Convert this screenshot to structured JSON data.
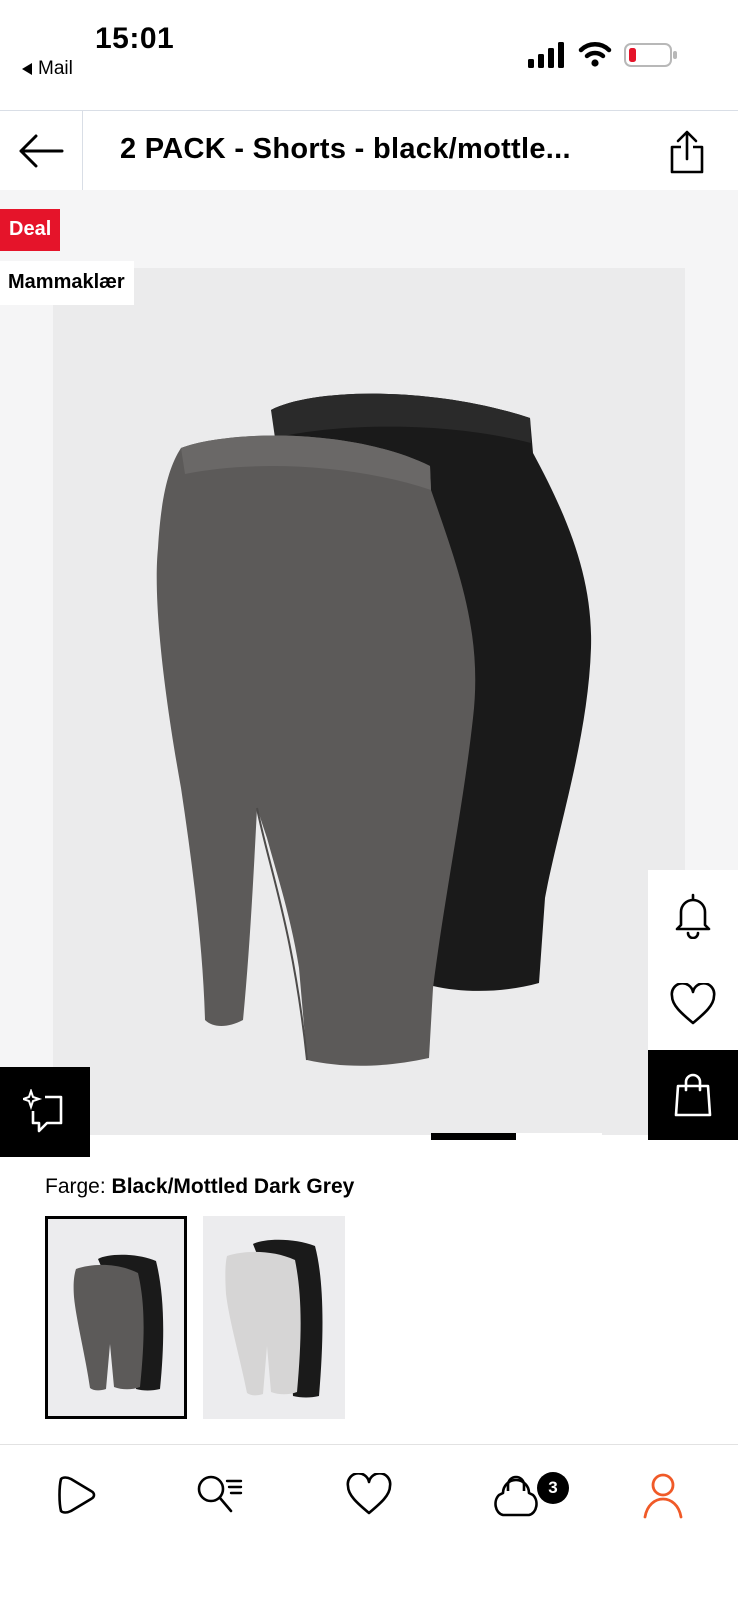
{
  "status_bar": {
    "time": "15:01",
    "back_app": "Mail"
  },
  "header": {
    "title": "2 PACK - Shorts - black/mottle..."
  },
  "badges": {
    "deal": "Deal",
    "brand": "Mammaklær"
  },
  "color_selector": {
    "label": "Farge:",
    "selected_value": "Black/Mottled Dark Grey",
    "options": [
      {
        "name": "black-mottled-dark-grey",
        "selected": true
      },
      {
        "name": "black-light-grey",
        "selected": false
      }
    ]
  },
  "gallery": {
    "pages": 2,
    "current_page": 1
  },
  "bottom_nav": {
    "items": [
      "home-icon",
      "search-icon",
      "wishlist-icon",
      "cart-icon",
      "account-icon"
    ],
    "cart_count": "3",
    "active_item": "account-icon"
  },
  "colors": {
    "accent": "#e5142a",
    "active_nav": "#f05a28",
    "battery_low": "#e5142a"
  }
}
